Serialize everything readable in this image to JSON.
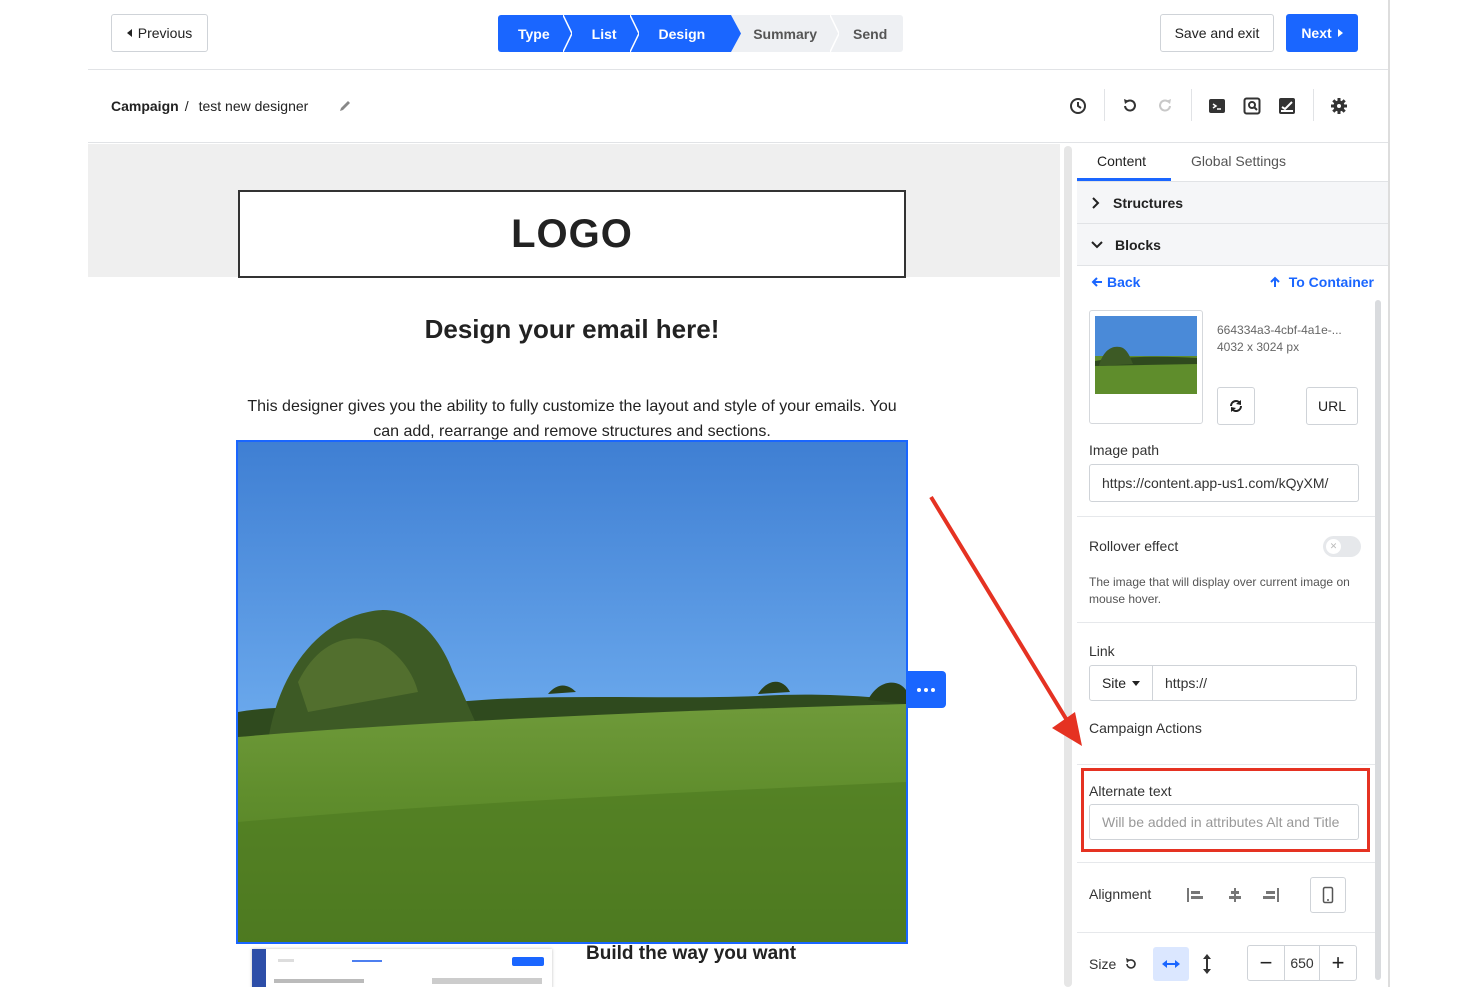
{
  "topbar": {
    "previous_label": "Previous",
    "save_exit_label": "Save and exit",
    "next_label": "Next",
    "steps": [
      {
        "label": "Type",
        "state": "done"
      },
      {
        "label": "List",
        "state": "done"
      },
      {
        "label": "Design",
        "state": "done"
      },
      {
        "label": "Summary",
        "state": "todo"
      },
      {
        "label": "Send",
        "state": "todo"
      }
    ]
  },
  "breadcrumb": {
    "root": "Campaign",
    "separator": "/",
    "name": "test new designer"
  },
  "toolbar_icons": [
    "history-icon",
    "undo-icon",
    "redo-icon",
    "code-icon",
    "preview-icon",
    "save-template-icon",
    "gear-icon"
  ],
  "canvas": {
    "logo_text": "LOGO",
    "heading": "Design your email here!",
    "paragraph": "This designer gives you the ability to fully customize the layout and style of your emails. You can add, rearrange and remove structures and sections.",
    "subheading": "Build the way you want"
  },
  "panel": {
    "tab_content": "Content",
    "tab_global": "Global Settings",
    "structures_label": "Structures",
    "blocks_label": "Blocks",
    "back_label": "Back",
    "to_container_label": "To Container",
    "image_name": "664334a3-4cbf-4a1e-...",
    "image_dims": "4032 x 3024 px",
    "url_button": "URL",
    "image_path_label": "Image path",
    "image_path_value": "https://content.app-us1.com/kQyXM/",
    "rollover_label": "Rollover effect",
    "rollover_hint": "The image that will display over current image on mouse hover.",
    "rollover_enabled": false,
    "link_label": "Link",
    "link_type": "Site",
    "link_value": "https://",
    "campaign_actions_label": "Campaign Actions",
    "alt_label": "Alternate text",
    "alt_placeholder": "Will be added in attributes Alt and Title",
    "alignment_label": "Alignment",
    "size_label": "Size",
    "size_value": "650"
  },
  "colors": {
    "primary": "#1a66ff",
    "annotation": "#e53222"
  }
}
